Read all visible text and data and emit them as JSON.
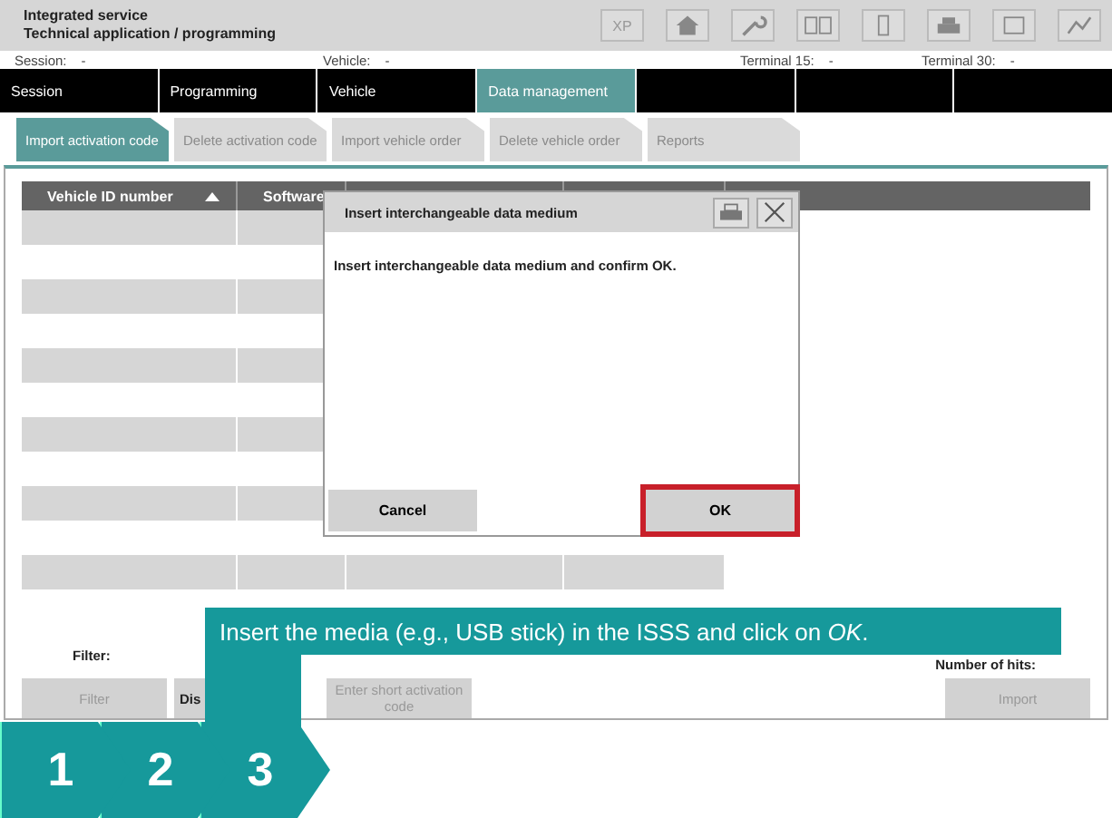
{
  "header": {
    "title": "Integrated service",
    "subtitle": "Technical application / programming",
    "toolbar": [
      {
        "kind": "text",
        "label": "XP"
      },
      {
        "kind": "home"
      },
      {
        "kind": "wrench"
      },
      {
        "kind": "book"
      },
      {
        "kind": "device"
      },
      {
        "kind": "printer"
      },
      {
        "kind": "box"
      },
      {
        "kind": "chart"
      }
    ]
  },
  "info": [
    {
      "label": "Session:",
      "value": "-"
    },
    {
      "label": "Vehicle:",
      "value": "-"
    },
    {
      "label": "Terminal 15:",
      "value": "-"
    },
    {
      "label": "Terminal 30:",
      "value": "-"
    }
  ],
  "nav": [
    {
      "label": "Session",
      "selected": false
    },
    {
      "label": "Programming",
      "selected": false
    },
    {
      "label": "Vehicle",
      "selected": false
    },
    {
      "label": "Data management",
      "selected": true
    }
  ],
  "subtabs": [
    {
      "label": "Import activation code",
      "selected": true,
      "disabled": false
    },
    {
      "label": "Delete activation code",
      "selected": false,
      "disabled": true
    },
    {
      "label": "Import vehicle order",
      "selected": false,
      "disabled": true
    },
    {
      "label": "Delete vehicle order",
      "selected": false,
      "disabled": true
    },
    {
      "label": "Reports",
      "selected": false,
      "disabled": true
    }
  ],
  "table": {
    "columns": [
      "Vehicle ID number",
      "Software"
    ]
  },
  "filter_label": "Filter:",
  "hits_label": "Number of hits:",
  "buttons": [
    {
      "label": "Filter",
      "disabled": true
    },
    {
      "label": "Dis",
      "disabled": false
    },
    {
      "label": "Enter short activation code",
      "disabled": true
    },
    {
      "label": "Import",
      "disabled": true
    }
  ],
  "dialog": {
    "title": "Insert interchangeable data medium",
    "message": "Insert interchangeable data medium and confirm OK.",
    "buttons": [
      {
        "label": "Cancel",
        "highlighted": false
      },
      {
        "label": "OK",
        "highlighted": true
      }
    ]
  },
  "callout": "Insert the media (e.g., USB stick) in the ISSS and click on *OK*.",
  "steps": [
    "1",
    "2",
    "3"
  ]
}
